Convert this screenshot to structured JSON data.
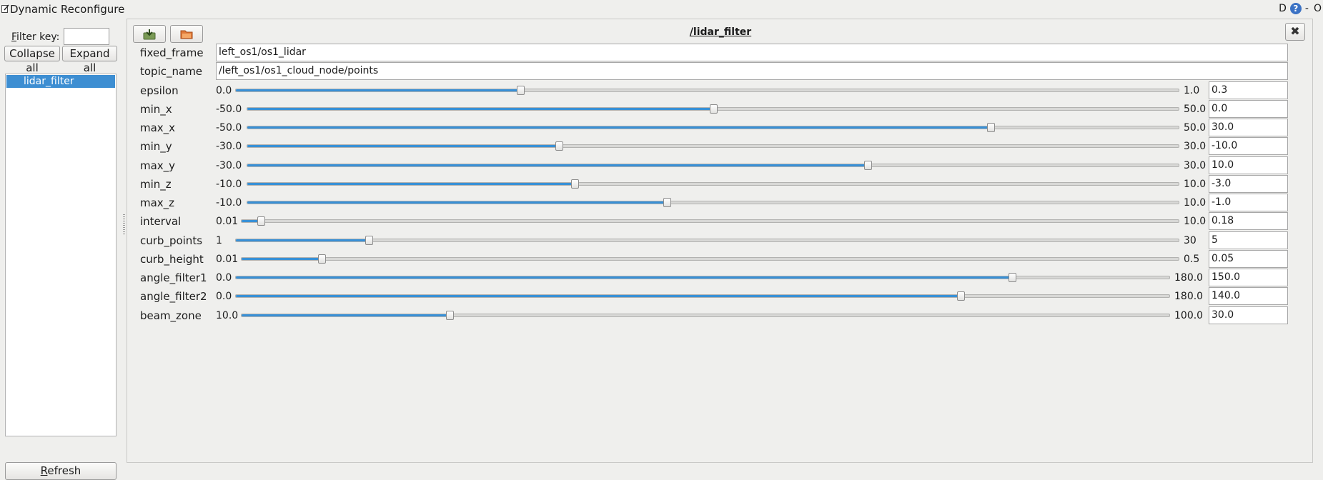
{
  "window": {
    "title": "Dynamic Reconfigure",
    "tb_d": "D",
    "tb_help": "?",
    "tb_min": "-",
    "tb_close": "O"
  },
  "sidebar": {
    "filter_label_accel": "F",
    "filter_label_rest": "ilter key:",
    "filter_value": "",
    "collapse_label": "Collapse all",
    "expand_label": "Expand all",
    "tree_items": [
      "lidar_filter"
    ],
    "refresh_accel": "R",
    "refresh_rest": "efresh"
  },
  "panel": {
    "node_name": "/lidar_filter",
    "close_glyph": "✖",
    "string_params": [
      {
        "name": "fixed_frame",
        "value": "left_os1/os1_lidar"
      },
      {
        "name": "topic_name",
        "value": "/left_os1/os1_cloud_node/points"
      }
    ],
    "sliders": [
      {
        "name": "epsilon",
        "min_label": "0.0",
        "max_label": "1.0",
        "value": "0.3",
        "frac": 0.3
      },
      {
        "name": "min_x",
        "min_label": "-50.0",
        "max_label": "50.0",
        "value": "0.0",
        "frac": 0.5
      },
      {
        "name": "max_x",
        "min_label": "-50.0",
        "max_label": "50.0",
        "value": "30.0",
        "frac": 0.8
      },
      {
        "name": "min_y",
        "min_label": "-30.0",
        "max_label": "30.0",
        "value": "-10.0",
        "frac": 0.3333
      },
      {
        "name": "max_y",
        "min_label": "-30.0",
        "max_label": "30.0",
        "value": "10.0",
        "frac": 0.6667
      },
      {
        "name": "min_z",
        "min_label": "-10.0",
        "max_label": "10.0",
        "value": "-3.0",
        "frac": 0.35
      },
      {
        "name": "max_z",
        "min_label": "-10.0",
        "max_label": "10.0",
        "value": "-1.0",
        "frac": 0.45
      },
      {
        "name": "interval",
        "min_label": "0.01",
        "max_label": "10.0",
        "value": "0.18",
        "frac": 0.017
      },
      {
        "name": "curb_points",
        "min_label": "1",
        "max_label": "30",
        "value": "5",
        "frac": 0.138
      },
      {
        "name": "curb_height",
        "min_label": "0.01",
        "max_label": "0.5",
        "value": "0.05",
        "frac": 0.082
      },
      {
        "name": "angle_filter1",
        "min_label": "0.0",
        "max_label": "180.0",
        "value": "150.0",
        "frac": 0.8333
      },
      {
        "name": "angle_filter2",
        "min_label": "0.0",
        "max_label": "180.0",
        "value": "140.0",
        "frac": 0.7778
      },
      {
        "name": "beam_zone",
        "min_label": "10.0",
        "max_label": "100.0",
        "value": "30.0",
        "frac": 0.2222
      }
    ]
  }
}
